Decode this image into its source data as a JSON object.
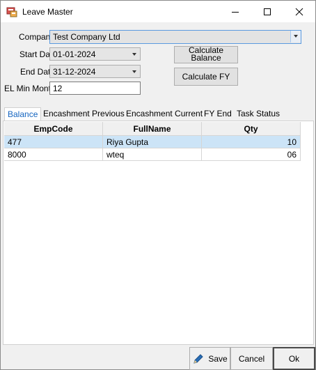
{
  "window": {
    "title": "Leave Master"
  },
  "form": {
    "company_label": "Compan",
    "company_value": "Test Company Ltd",
    "start_label": "Start Dat",
    "start_value": "01-01-2024",
    "end_label": "End Dat",
    "end_value": "31-12-2024",
    "elmin_label": "EL Min Mont",
    "elmin_value": "12"
  },
  "buttons": {
    "calc_balance": "Calculate Balance",
    "calc_fy": "Calculate FY",
    "save": "Save",
    "cancel": "Cancel",
    "ok": "Ok"
  },
  "tabs": [
    "Balance",
    "Encashment Previous",
    "Encashment Current",
    "FY End",
    "Task Status"
  ],
  "grid": {
    "columns": [
      "EmpCode",
      "FullName",
      "Qty"
    ],
    "rows": [
      [
        "477",
        "Riya Gupta",
        "10"
      ],
      [
        "8000",
        "wteq",
        "06"
      ]
    ]
  }
}
